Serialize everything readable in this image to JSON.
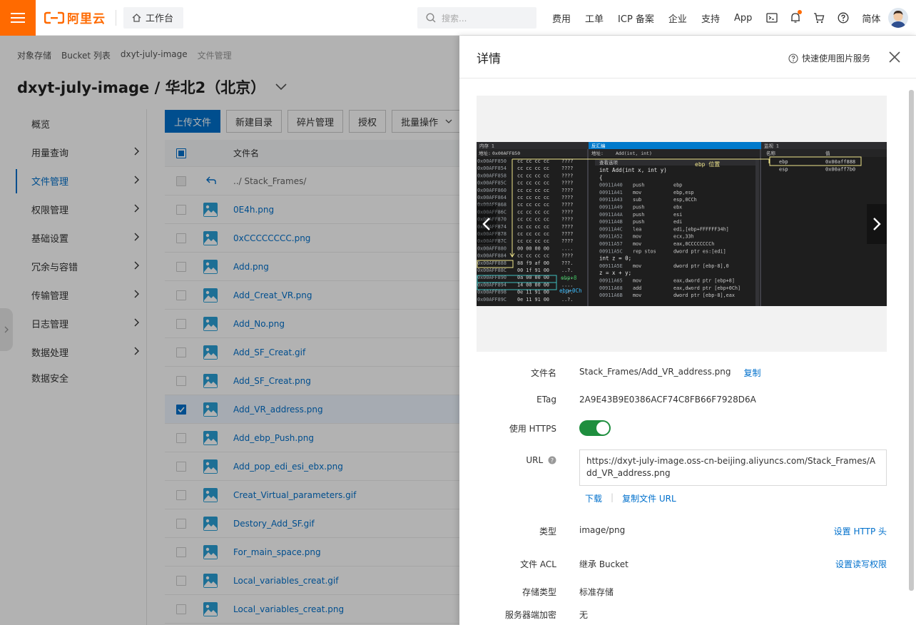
{
  "header": {
    "logo_text": "阿里云",
    "workbench_label": "工作台",
    "search_placeholder": "搜索...",
    "nav": [
      "费用",
      "工单",
      "ICP 备案",
      "企业",
      "支持",
      "App"
    ],
    "lang_label": "简体",
    "brand_color": "#ff6a00"
  },
  "breadcrumb": [
    "对象存储",
    "Bucket 列表",
    "dxyt-july-image",
    "文件管理"
  ],
  "page_title": "dxyt-july-image / 华北2（北京）",
  "sidebar": {
    "items": [
      {
        "label": "概览",
        "has_arrow": false
      },
      {
        "label": "用量查询",
        "has_arrow": true
      },
      {
        "label": "文件管理",
        "has_arrow": true,
        "active": true
      },
      {
        "label": "权限管理",
        "has_arrow": true
      },
      {
        "label": "基础设置",
        "has_arrow": true
      },
      {
        "label": "冗余与容错",
        "has_arrow": true
      },
      {
        "label": "传输管理",
        "has_arrow": true
      },
      {
        "label": "日志管理",
        "has_arrow": true
      },
      {
        "label": "数据处理",
        "has_arrow": true
      },
      {
        "label": "数据安全",
        "has_arrow": false
      }
    ]
  },
  "toolbar": {
    "upload": "上传文件",
    "new_dir": "新建目录",
    "fragments": "碎片管理",
    "authorize": "授权",
    "batch": "批量操作"
  },
  "file_table": {
    "header": "文件名",
    "parent": "../ Stack_Frames/",
    "files": [
      {
        "name": "0E4h.png",
        "checked": false
      },
      {
        "name": "0xCCCCCCCC.png",
        "checked": false
      },
      {
        "name": "Add.png",
        "checked": false
      },
      {
        "name": "Add_Creat_VR.png",
        "checked": false
      },
      {
        "name": "Add_No.png",
        "checked": false
      },
      {
        "name": "Add_SF_Creat.gif",
        "checked": false
      },
      {
        "name": "Add_SF_Creat.png",
        "checked": false
      },
      {
        "name": "Add_VR_address.png",
        "checked": true
      },
      {
        "name": "Add_ebp_Push.png",
        "checked": false
      },
      {
        "name": "Add_pop_edi_esi_ebx.png",
        "checked": false
      },
      {
        "name": "Creat_Virtual_parameters.gif",
        "checked": false
      },
      {
        "name": "Destory_Add_SF.gif",
        "checked": false
      },
      {
        "name": "For_main_space.png",
        "checked": false
      },
      {
        "name": "Local_variables_creat.gif",
        "checked": false
      },
      {
        "name": "Local_variables_creat.png",
        "checked": false
      }
    ]
  },
  "drawer": {
    "title": "详情",
    "quick_help": "快速使用图片服务",
    "preview_screenshot": {
      "mem_tab": "内存 1",
      "disasm_tab": "反汇编",
      "watch_tab": "监视 1",
      "address_label": "地址:",
      "mem_address": "0x00AFF850",
      "disasm_address": "Add(int, int)",
      "view_options": "查看选项",
      "ebp_pos_label": "ebp 位置",
      "mem_rows": [
        {
          "addr": "0x00AFF850",
          "bytes": "cc cc cc cc",
          "ascii": "????"
        },
        {
          "addr": "0x00AFF854",
          "bytes": "cc cc cc cc",
          "ascii": "????"
        },
        {
          "addr": "0x00AFF858",
          "bytes": "cc cc cc cc",
          "ascii": "????"
        },
        {
          "addr": "0x00AFF85C",
          "bytes": "cc cc cc cc",
          "ascii": "????"
        },
        {
          "addr": "0x00AFF860",
          "bytes": "cc cc cc cc",
          "ascii": "????"
        },
        {
          "addr": "0x00AFF864",
          "bytes": "cc cc cc cc",
          "ascii": "????"
        },
        {
          "addr": "0x00AFF868",
          "bytes": "cc cc cc cc",
          "ascii": "????"
        },
        {
          "addr": "0x00AFF86C",
          "bytes": "cc cc cc cc",
          "ascii": "????"
        },
        {
          "addr": "0x00AFF870",
          "bytes": "cc cc cc cc",
          "ascii": "????"
        },
        {
          "addr": "0x00AFF874",
          "bytes": "cc cc cc cc",
          "ascii": "????"
        },
        {
          "addr": "0x00AFF878",
          "bytes": "cc cc cc cc",
          "ascii": "????"
        },
        {
          "addr": "0x00AFF87C",
          "bytes": "cc cc cc cc",
          "ascii": "????"
        },
        {
          "addr": "0x00AFF880",
          "bytes": "00 00 00 00",
          "ascii": "...."
        },
        {
          "addr": "0x00AFF884",
          "bytes": "cc cc cc cc",
          "ascii": "????"
        },
        {
          "addr": "0x00AFF888",
          "bytes": "88 f9 af 00",
          "ascii": "???."
        },
        {
          "addr": "0x00AFF88C",
          "bytes": "00 1f 91 00",
          "ascii": "..?."
        },
        {
          "addr": "0x00AFF890",
          "bytes": "0a 00 00 00",
          "ascii": "...."
        },
        {
          "addr": "0x00AFF894",
          "bytes": "14 00 00 00",
          "ascii": "...."
        },
        {
          "addr": "0x00AFF898",
          "bytes": "0e 11 91 00",
          "ascii": "..?."
        },
        {
          "addr": "0x00AFF89C",
          "bytes": "0e 11 91 00",
          "ascii": "..?."
        }
      ],
      "ebp8": "ebp+8",
      "ebp0c": "ebp+0Ch",
      "disasm_lines": [
        {
          "t": "src",
          "text": "int Add(int x, int y)"
        },
        {
          "t": "src",
          "text": "{"
        },
        {
          "t": "asm",
          "addr": "00911A40",
          "op": "push",
          "arg": "ebp"
        },
        {
          "t": "asm",
          "addr": "00911A41",
          "op": "mov",
          "arg": "ebp,esp"
        },
        {
          "t": "asm",
          "addr": "00911A43",
          "op": "sub",
          "arg": "esp,0CCh"
        },
        {
          "t": "asm",
          "addr": "00911A49",
          "op": "push",
          "arg": "ebx"
        },
        {
          "t": "asm",
          "addr": "00911A4A",
          "op": "push",
          "arg": "esi"
        },
        {
          "t": "asm",
          "addr": "00911A4B",
          "op": "push",
          "arg": "edi"
        },
        {
          "t": "asm",
          "addr": "00911A4C",
          "op": "lea",
          "arg": "edi,[ebp+FFFFFF34h]"
        },
        {
          "t": "asm",
          "addr": "00911A52",
          "op": "mov",
          "arg": "ecx,33h"
        },
        {
          "t": "asm",
          "addr": "00911A57",
          "op": "mov",
          "arg": "eax,0CCCCCCCCh"
        },
        {
          "t": "asm",
          "addr": "00911A5C",
          "op": "rep stos",
          "arg": "dword ptr es:[edi]"
        },
        {
          "t": "src",
          "text": "    int z = 0;"
        },
        {
          "t": "asm",
          "addr": "00911A5E",
          "op": "mov",
          "arg": "dword ptr [ebp-8],0"
        },
        {
          "t": "src",
          "text": "    z = x + y;"
        },
        {
          "t": "asm",
          "addr": "00911A65",
          "op": "mov",
          "arg": "eax,dword ptr [ebp+8]"
        },
        {
          "t": "asm",
          "addr": "00911A68",
          "op": "add",
          "arg": "eax,dword ptr [ebp+0Ch]"
        },
        {
          "t": "asm",
          "addr": "00911A6B",
          "op": "mov",
          "arg": "dword ptr [ebp-8],eax"
        }
      ],
      "watch_headers": [
        "名称",
        "值"
      ],
      "watch_rows": [
        {
          "name": "ebp",
          "value": "0x00aff888"
        },
        {
          "name": "esp",
          "value": "0x00aff7b0"
        }
      ]
    },
    "props": {
      "filename_label": "文件名",
      "filename_value": "Stack_Frames/Add_VR_address.png",
      "copy_label": "复制",
      "etag_label": "ETag",
      "etag_value": "2A9E43B9E0386ACF74C8FB66F7928D6A",
      "https_label": "使用 HTTPS",
      "https_on": true,
      "url_label": "URL",
      "url_value": "https://dxyt-july-image.oss-cn-beijing.aliyuncs.com/Stack_Frames/Add_VR_address.png",
      "download_label": "下载",
      "copy_url_label": "复制文件 URL",
      "type_label": "类型",
      "type_value": "image/png",
      "set_http_header": "设置 HTTP 头",
      "acl_label": "文件 ACL",
      "acl_value": "继承 Bucket",
      "set_acl": "设置读写权限",
      "storage_label": "存储类型",
      "storage_value": "标准存储",
      "encrypt_label": "服务器端加密",
      "encrypt_value": "无"
    }
  }
}
